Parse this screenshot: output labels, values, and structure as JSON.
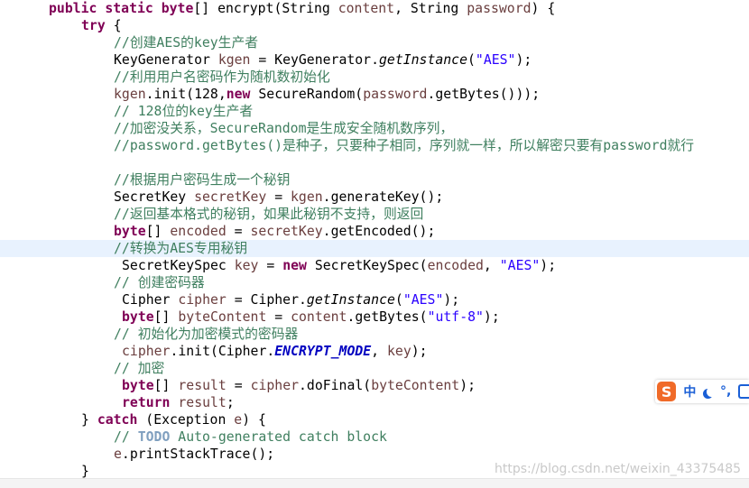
{
  "editor": {
    "lines": [
      {
        "indent": 54,
        "tokens": [
          [
            "kw",
            "public static byte"
          ],
          [
            "",
            "[] encrypt(String "
          ],
          [
            "var",
            "content"
          ],
          [
            "",
            ", String "
          ],
          [
            "var",
            "password"
          ],
          [
            "",
            ") {"
          ]
        ]
      },
      {
        "indent": 90,
        "tokens": [
          [
            "kw",
            "try"
          ],
          [
            "",
            " {"
          ]
        ]
      },
      {
        "indent": 126,
        "tokens": [
          [
            "cmt",
            "//创建AES的key生产者"
          ]
        ]
      },
      {
        "indent": 126,
        "tokens": [
          [
            "",
            "KeyGenerator "
          ],
          [
            "var",
            "kgen"
          ],
          [
            "",
            " = KeyGenerator."
          ],
          [
            "mth",
            "getInstance"
          ],
          [
            "",
            "("
          ],
          [
            "str",
            "\"AES\""
          ],
          [
            "",
            ");"
          ]
        ]
      },
      {
        "indent": 126,
        "tokens": [
          [
            "cmt",
            "//利用用户名密码作为随机数初始化"
          ]
        ]
      },
      {
        "indent": 126,
        "tokens": [
          [
            "var",
            "kgen"
          ],
          [
            "",
            ".init(128,"
          ],
          [
            "kw",
            "new"
          ],
          [
            "",
            " SecureRandom("
          ],
          [
            "var",
            "password"
          ],
          [
            "",
            ".getBytes()));"
          ]
        ]
      },
      {
        "indent": 126,
        "tokens": [
          [
            "cmt",
            "// 128位的key生产者"
          ]
        ]
      },
      {
        "indent": 126,
        "tokens": [
          [
            "cmt",
            "//加密没关系，SecureRandom是生成安全随机数序列，"
          ]
        ]
      },
      {
        "indent": 126,
        "tokens": [
          [
            "cmt",
            "//password.getBytes()是种子，只要种子相同，序列就一样，所以解密只要有password就行"
          ]
        ]
      },
      {
        "indent": 126,
        "tokens": []
      },
      {
        "indent": 126,
        "tokens": [
          [
            "cmt",
            "//根据用户密码生成一个秘钥"
          ]
        ]
      },
      {
        "indent": 126,
        "tokens": [
          [
            "",
            "SecretKey "
          ],
          [
            "var",
            "secretKey"
          ],
          [
            "",
            " = "
          ],
          [
            "var",
            "kgen"
          ],
          [
            "",
            ".generateKey();"
          ]
        ]
      },
      {
        "indent": 126,
        "tokens": [
          [
            "cmt",
            "//返回基本格式的秘钥，如果此秘钥不支持，则返回"
          ]
        ]
      },
      {
        "indent": 126,
        "tokens": [
          [
            "kw",
            "byte"
          ],
          [
            "",
            "[] "
          ],
          [
            "var",
            "encoded"
          ],
          [
            "",
            " = "
          ],
          [
            "var",
            "secretKey"
          ],
          [
            "",
            ".getEncoded();"
          ]
        ]
      },
      {
        "indent": 126,
        "current": true,
        "tokens": [
          [
            "cmt",
            "//转换为AES专用秘钥"
          ]
        ]
      },
      {
        "indent": 135,
        "tokens": [
          [
            "",
            "SecretKeySpec "
          ],
          [
            "var",
            "key"
          ],
          [
            "",
            " = "
          ],
          [
            "kw",
            "new"
          ],
          [
            "",
            " SecretKeySpec("
          ],
          [
            "var",
            "encoded"
          ],
          [
            "",
            ", "
          ],
          [
            "str",
            "\"AES\""
          ],
          [
            "",
            ");"
          ]
        ]
      },
      {
        "indent": 126,
        "tokens": [
          [
            "cmt",
            "// 创建密码器"
          ]
        ]
      },
      {
        "indent": 135,
        "tokens": [
          [
            "",
            "Cipher "
          ],
          [
            "var",
            "cipher"
          ],
          [
            "",
            " = Cipher."
          ],
          [
            "mth",
            "getInstance"
          ],
          [
            "",
            "("
          ],
          [
            "str",
            "\"AES\""
          ],
          [
            "",
            ");"
          ]
        ]
      },
      {
        "indent": 135,
        "tokens": [
          [
            "kw",
            "byte"
          ],
          [
            "",
            "[] "
          ],
          [
            "var",
            "byteContent"
          ],
          [
            "",
            " = "
          ],
          [
            "var",
            "content"
          ],
          [
            "",
            ".getBytes("
          ],
          [
            "str",
            "\"utf-8\""
          ],
          [
            "",
            ");"
          ]
        ]
      },
      {
        "indent": 126,
        "tokens": [
          [
            "cmt",
            "// 初始化为加密模式的密码器"
          ]
        ]
      },
      {
        "indent": 135,
        "tokens": [
          [
            "var",
            "cipher"
          ],
          [
            "",
            ".init(Cipher."
          ],
          [
            "cst",
            "ENCRYPT_MODE"
          ],
          [
            "",
            ", "
          ],
          [
            "var",
            "key"
          ],
          [
            "",
            ");"
          ]
        ]
      },
      {
        "indent": 126,
        "tokens": [
          [
            "cmt",
            "// 加密"
          ]
        ]
      },
      {
        "indent": 135,
        "tokens": [
          [
            "kw",
            "byte"
          ],
          [
            "",
            "[] "
          ],
          [
            "var",
            "result"
          ],
          [
            "",
            " = "
          ],
          [
            "var",
            "cipher"
          ],
          [
            "",
            ".doFinal("
          ],
          [
            "var",
            "byteContent"
          ],
          [
            "",
            ");"
          ]
        ]
      },
      {
        "indent": 135,
        "tokens": [
          [
            "kw",
            "return"
          ],
          [
            "",
            " "
          ],
          [
            "var",
            "result"
          ],
          [
            "",
            ";"
          ]
        ]
      },
      {
        "indent": 90,
        "tokens": [
          [
            "",
            "} "
          ],
          [
            "kw",
            "catch"
          ],
          [
            "",
            " (Exception "
          ],
          [
            "var",
            "e"
          ],
          [
            "",
            ") {"
          ]
        ]
      },
      {
        "indent": 126,
        "tokens": [
          [
            "cmt",
            "// "
          ],
          [
            "todo",
            "TODO"
          ],
          [
            "cmt",
            " Auto-generated catch block"
          ]
        ]
      },
      {
        "indent": 126,
        "tokens": [
          [
            "var",
            "e"
          ],
          [
            "",
            ".printStackTrace();"
          ]
        ]
      },
      {
        "indent": 90,
        "tokens": [
          [
            "",
            "}"
          ]
        ]
      }
    ]
  },
  "ime": {
    "logo": "S",
    "mode_label": "中",
    "punct_label": "°,",
    "icons": [
      "sogou-logo-icon",
      "moon-icon",
      "settings-grid-icon"
    ]
  },
  "watermark": "https://blog.csdn.net/weixin_43375485",
  "colors": {
    "keyword": "#7f0055",
    "variable": "#6a3e3e",
    "string": "#2a00ff",
    "comment": "#3f7f5f",
    "todo": "#7f9fbf",
    "constant": "#0000c0",
    "current_line": "#e8f2fe",
    "ime_accent": "#1a5fd6",
    "ime_logo": "#f06a28"
  }
}
